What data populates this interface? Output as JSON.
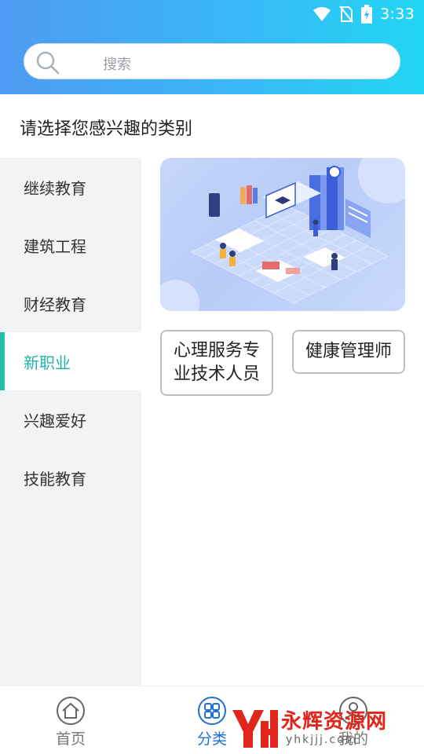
{
  "status_bar": {
    "time": "3:33"
  },
  "search": {
    "placeholder": "搜索"
  },
  "page_title": "请选择您感兴趣的类别",
  "sidebar": {
    "items": [
      {
        "label": "继续教育",
        "active": false
      },
      {
        "label": "建筑工程",
        "active": false
      },
      {
        "label": "财经教育",
        "active": false
      },
      {
        "label": "新职业",
        "active": true
      },
      {
        "label": "兴趣爱好",
        "active": false
      },
      {
        "label": "技能教育",
        "active": false
      }
    ]
  },
  "tags": [
    {
      "label": "心理服务专业技术人员"
    },
    {
      "label": "健康管理师"
    }
  ],
  "bottom_nav": {
    "items": [
      {
        "label": "首页",
        "icon": "home-icon",
        "active": false
      },
      {
        "label": "分类",
        "icon": "category-icon",
        "active": true
      },
      {
        "label": "我的",
        "icon": "profile-icon",
        "active": false
      }
    ]
  },
  "watermark": {
    "text": "永辉资源网",
    "url": "yhkjjj.com"
  },
  "colors": {
    "header_start": "#4f9bf3",
    "header_end": "#22d6f3",
    "accent": "#1fc1a8",
    "active_text": "#23b3a7",
    "nav_active": "#1f6fd6"
  }
}
